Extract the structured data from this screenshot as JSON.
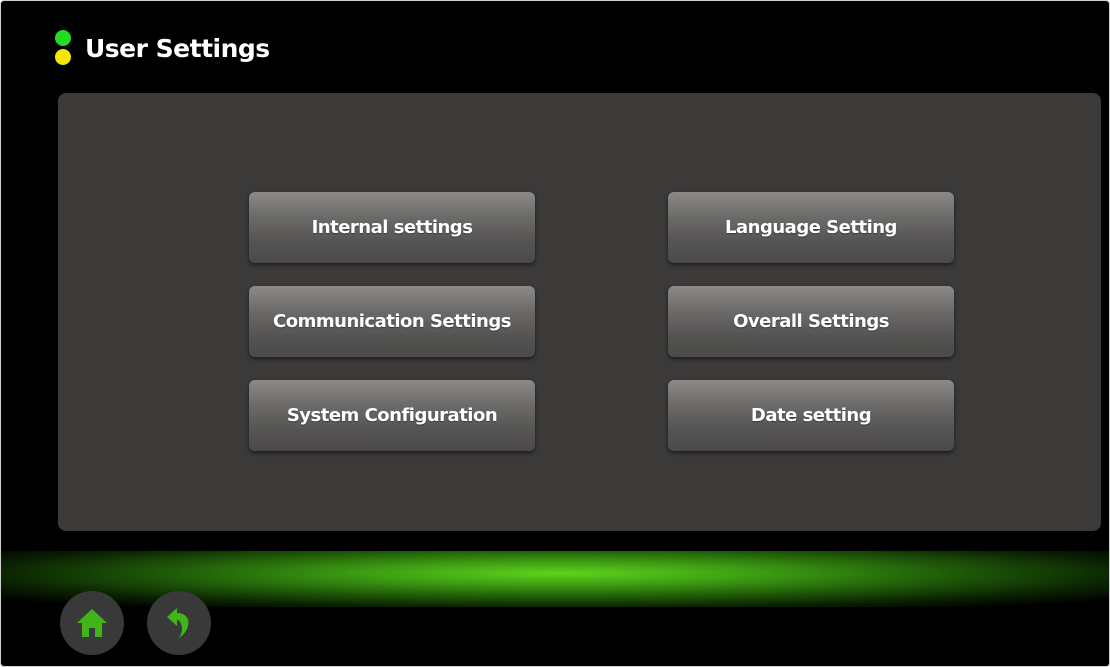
{
  "header": {
    "title": "User Settings",
    "status_leds": [
      {
        "name": "green-led",
        "color": "#22dd22"
      },
      {
        "name": "yellow-led",
        "color": "#f5e600"
      }
    ]
  },
  "menu": {
    "buttons": [
      {
        "label": "Internal settings"
      },
      {
        "label": "Language Setting"
      },
      {
        "label": "Communication Settings"
      },
      {
        "label": "Overall Settings"
      },
      {
        "label": "System Configuration"
      },
      {
        "label": "Date setting"
      }
    ]
  },
  "navigation": {
    "home": {
      "icon": "home-icon",
      "color": "#3fb51a"
    },
    "back": {
      "icon": "back-arrow-icon",
      "color": "#3fb51a"
    }
  },
  "theme": {
    "background": "#000000",
    "panel": "#3b3a39",
    "accent": "#3fb51a"
  }
}
